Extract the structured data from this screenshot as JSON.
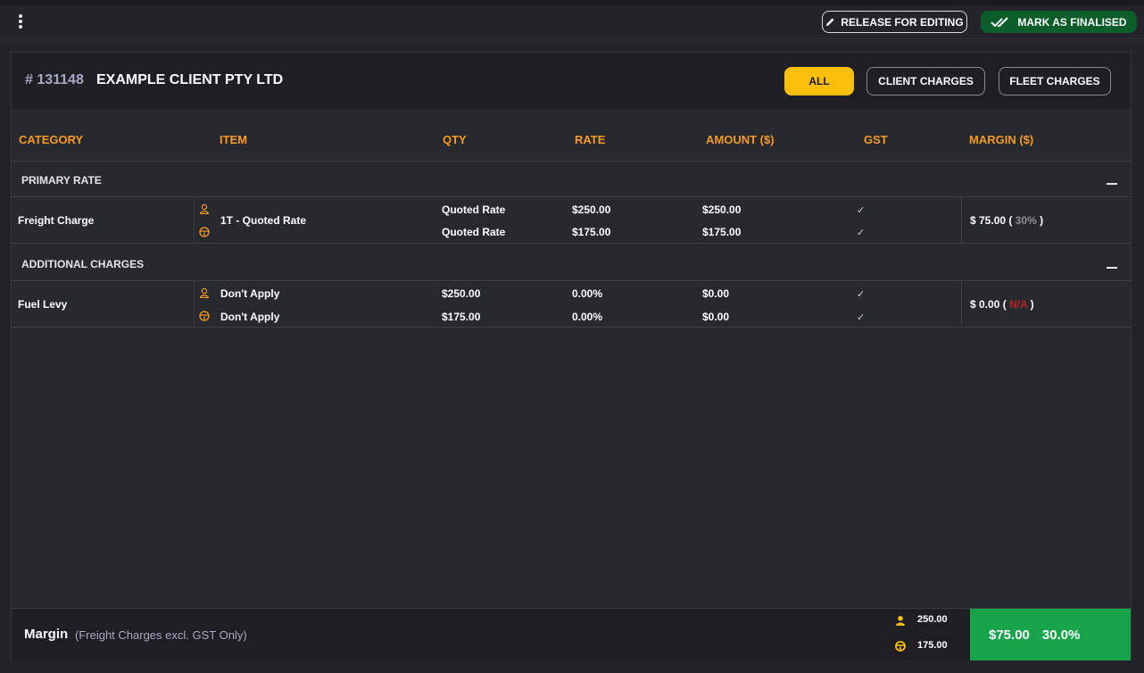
{
  "toolbar": {
    "release_label": "RELEASE FOR EDITING",
    "finalise_label": "MARK AS FINALISED"
  },
  "job": {
    "number": "# 131148",
    "client": "EXAMPLE CLIENT PTY LTD"
  },
  "filters": {
    "all": "ALL",
    "client": "CLIENT CHARGES",
    "fleet": "FLEET CHARGES",
    "active": "all"
  },
  "columns": {
    "category": "CATEGORY",
    "item": "ITEM",
    "qty": "QTY",
    "rate": "RATE",
    "amount": "AMOUNT ($)",
    "gst": "GST",
    "margin": "MARGIN ($)"
  },
  "sections": [
    {
      "title": "PRIMARY RATE",
      "rows": [
        {
          "category": "Freight Charge",
          "item": "1T - Quoted Rate",
          "client": {
            "qty": "Quoted Rate",
            "rate": "$250.00",
            "amount": "$250.00",
            "gst": true
          },
          "fleet": {
            "qty": "Quoted Rate",
            "rate": "$175.00",
            "amount": "$175.00",
            "gst": true
          },
          "margin_value": "$ 75.00",
          "margin_open": "(",
          "margin_pct": "30%",
          "margin_close": ")"
        }
      ]
    },
    {
      "title": "ADDITIONAL CHARGES",
      "rows": [
        {
          "category": "Fuel Levy",
          "client": {
            "item": "Don't Apply",
            "qty": "$250.00",
            "rate": "0.00%",
            "amount": "$0.00",
            "gst": true
          },
          "fleet": {
            "item": "Don't Apply",
            "qty": "$175.00",
            "rate": "0.00%",
            "amount": "$0.00",
            "gst": true
          },
          "margin_value": "$ 0.00",
          "margin_open": "(",
          "margin_pct": "N/A",
          "margin_close": ")"
        }
      ]
    }
  ],
  "footer": {
    "label": "Margin",
    "sub": "(Freight Charges excl. GST Only)",
    "client_total": "250.00",
    "fleet_total": "175.00",
    "margin_amount": "$75.00",
    "margin_pct": "30.0%"
  },
  "colors": {
    "accent": "#fbbf0a",
    "header_text": "#f59a23",
    "finalise_bg": "#0b5e2a",
    "margin_bg": "#17a34a",
    "na": "#b3261e"
  },
  "icons": {
    "client": "person-icon",
    "fleet": "steering-wheel-icon",
    "gst": "check-icon"
  }
}
